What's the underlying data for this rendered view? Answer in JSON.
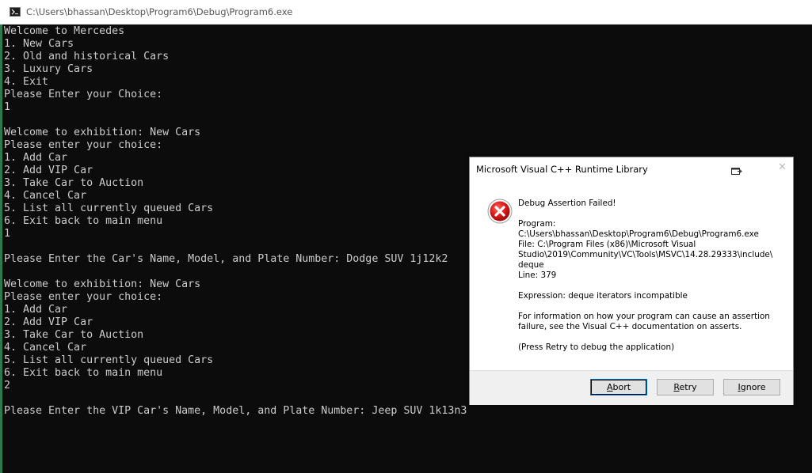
{
  "window": {
    "title": "C:\\Users\\bhassan\\Desktop\\Program6\\Debug\\Program6.exe"
  },
  "console": {
    "lines": [
      "Welcome to Mercedes",
      "1. New Cars",
      "2. Old and historical Cars",
      "3. Luxury Cars",
      "4. Exit",
      "Please Enter your Choice:",
      "1",
      "",
      "Welcome to exhibition: New Cars",
      "Please enter your choice:",
      "1. Add Car",
      "2. Add VIP Car",
      "3. Take Car to Auction",
      "4. Cancel Car",
      "5. List all currently queued Cars",
      "6. Exit back to main menu",
      "1",
      "",
      "Please Enter the Car's Name, Model, and Plate Number: Dodge SUV 1j12k2",
      "",
      "Welcome to exhibition: New Cars",
      "Please enter your choice:",
      "1. Add Car",
      "2. Add VIP Car",
      "3. Take Car to Auction",
      "4. Cancel Car",
      "5. List all currently queued Cars",
      "6. Exit back to main menu",
      "2",
      "",
      "Please Enter the VIP Car's Name, Model, and Plate Number: Jeep SUV 1k13n3"
    ]
  },
  "dialog": {
    "title": "Microsoft Visual C++ Runtime Library",
    "heading": "Debug Assertion Failed!",
    "program_label": "Program:",
    "program_path": "C:\\Users\\bhassan\\Desktop\\Program6\\Debug\\Program6.exe",
    "file_line1": "File: C:\\Program Files (x86)\\Microsoft Visual",
    "file_line2": "Studio\\2019\\Community\\VC\\Tools\\MSVC\\14.28.29333\\include\\",
    "file_line3": "deque",
    "line_info": "Line: 379",
    "expression": "Expression: deque iterators incompatible",
    "info_line1": "For information on how your program can cause an assertion",
    "info_line2": "failure, see the Visual C++ documentation on asserts.",
    "retry_hint": "(Press Retry to debug the application)",
    "buttons": {
      "abort_first": "A",
      "abort_rest": "bort",
      "retry_first": "R",
      "retry_rest": "etry",
      "ignore_first": "I",
      "ignore_rest": "gnore"
    }
  }
}
